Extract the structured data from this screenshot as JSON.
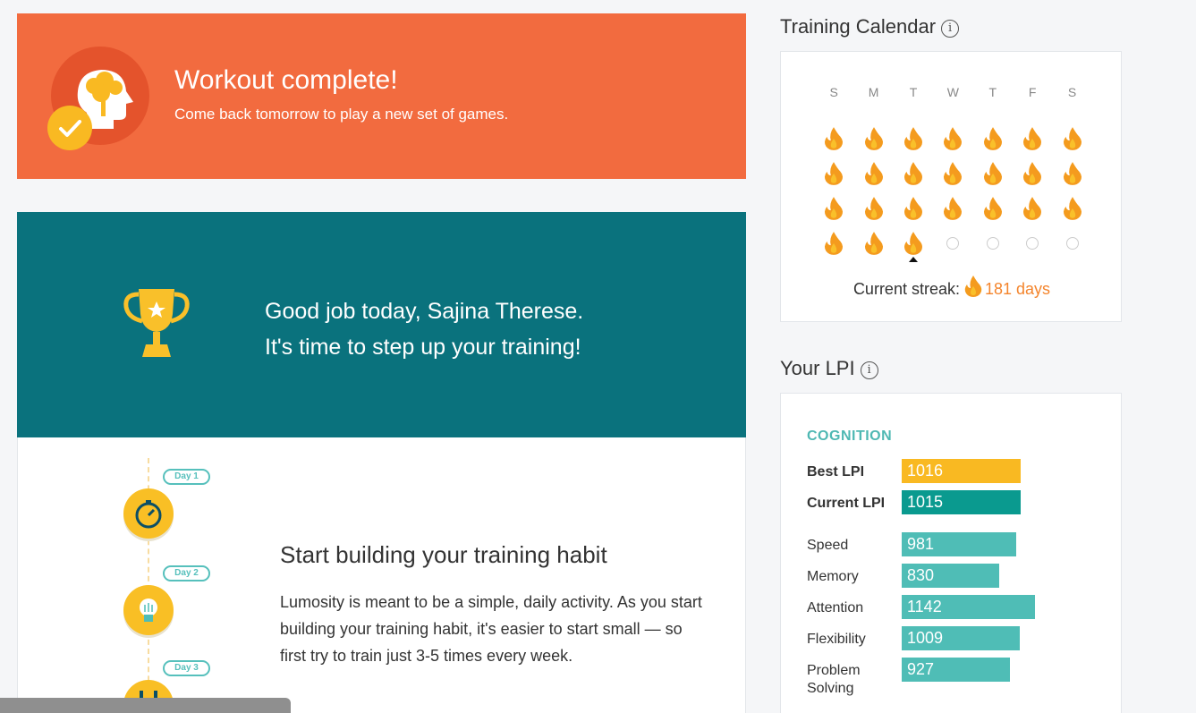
{
  "workout": {
    "title": "Workout complete!",
    "subtitle": "Come back tomorrow to play a new set of games."
  },
  "promo": {
    "headline_line1": "Good job today, Sajina Therese.",
    "headline_line2": "It's time to step up your training!",
    "days": [
      "Day 1",
      "Day 2",
      "Day 3"
    ],
    "habit_title": "Start building your training habit",
    "habit_body": "Lumosity is meant to be a simple, daily activity. As you start building your training habit, it's easier to start small — so first try to train just 3-5 times every week."
  },
  "calendar": {
    "title": "Training Calendar",
    "info_icon": "info-icon",
    "weekdays": [
      "S",
      "M",
      "T",
      "W",
      "T",
      "F",
      "S"
    ],
    "weeks": [
      [
        "done",
        "done",
        "done",
        "done",
        "done",
        "done",
        "done"
      ],
      [
        "done",
        "done",
        "done",
        "done",
        "done",
        "done",
        "done"
      ],
      [
        "done",
        "done",
        "done",
        "done",
        "done",
        "done",
        "done"
      ],
      [
        "done",
        "done",
        "today",
        "empty",
        "empty",
        "empty",
        "empty"
      ]
    ],
    "streak_label": "Current streak:",
    "streak_value": "181 days"
  },
  "lpi": {
    "title": "Your LPI",
    "info_icon": "info-icon",
    "category": "COGNITION",
    "scale_max": 1300,
    "best": {
      "label": "Best LPI",
      "value": 1016,
      "color": "#f9b922"
    },
    "current": {
      "label": "Current LPI",
      "value": 1015,
      "color": "#0a9a8f"
    },
    "areas": [
      {
        "label": "Speed",
        "value": 981
      },
      {
        "label": "Memory",
        "value": 830
      },
      {
        "label": "Attention",
        "value": 1142
      },
      {
        "label": "Flexibility",
        "value": 1009
      },
      {
        "label": "Problem Solving",
        "value": 927
      }
    ],
    "area_color": "#4fbdb6"
  },
  "colors": {
    "workout_bg": "#f26b3f",
    "promo_bg": "#0a727d",
    "streak": "#f4852d",
    "flame": "#f49b1e"
  }
}
